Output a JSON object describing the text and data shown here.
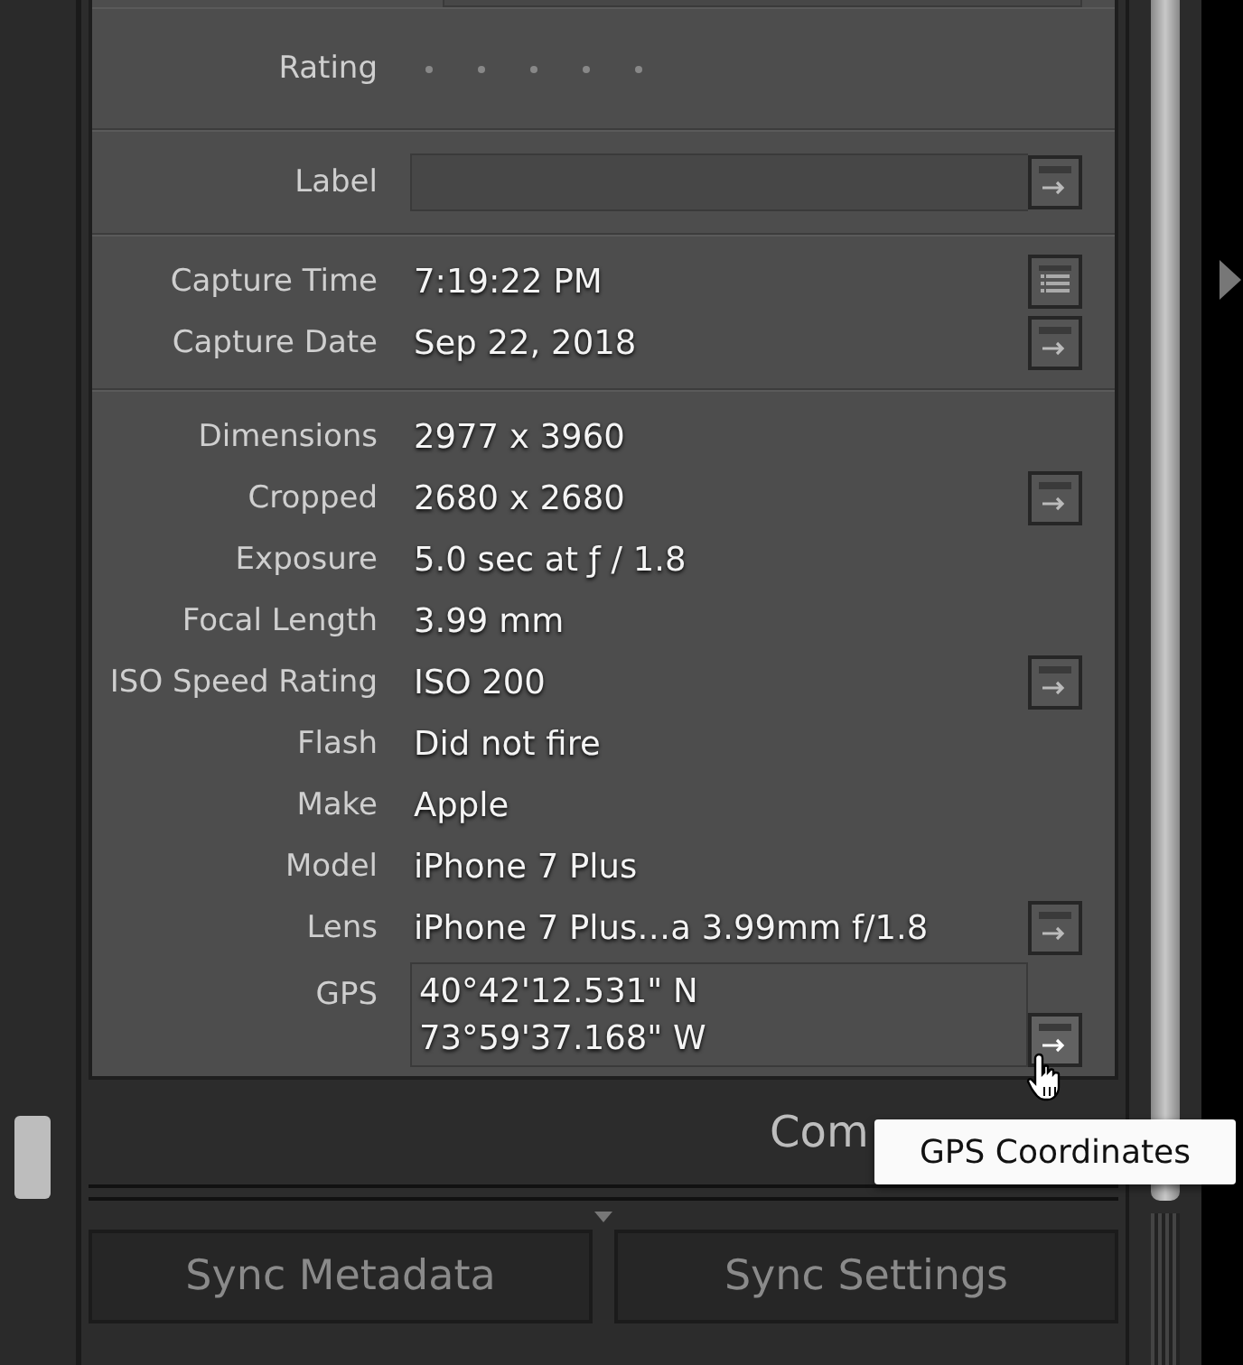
{
  "rating": {
    "label": "Rating",
    "stars": 0
  },
  "label_field": {
    "label": "Label",
    "button": {
      "kind": "arrow",
      "hovered": false
    }
  },
  "sections": [
    {
      "rows": [
        {
          "label": "Capture Time",
          "value": "7:19:22 PM",
          "button": {
            "kind": "list",
            "hovered": false
          }
        },
        {
          "label": "Capture Date",
          "value": "Sep 22, 2018",
          "button": {
            "kind": "arrow",
            "hovered": false
          }
        }
      ]
    },
    {
      "rows": [
        {
          "label": "Dimensions",
          "value": "2977 x 3960"
        },
        {
          "label": "Cropped",
          "value": "2680 x 2680",
          "button": {
            "kind": "arrow",
            "hovered": false
          }
        },
        {
          "label": "Exposure",
          "value": "5.0 sec at ƒ / 1.8"
        },
        {
          "label": "Focal Length",
          "value": "3.99 mm"
        },
        {
          "label": "ISO Speed Rating",
          "value": "ISO 200",
          "button": {
            "kind": "arrow",
            "hovered": false
          }
        },
        {
          "label": "Flash",
          "value": "Did not fire"
        },
        {
          "label": "Make",
          "value": "Apple"
        },
        {
          "label": "Model",
          "value": "iPhone 7 Plus"
        },
        {
          "label": "Lens",
          "value": "iPhone 7 Plus…a 3.99mm f/1.8",
          "button": {
            "kind": "arrow",
            "hovered": false
          }
        },
        {
          "label": "GPS",
          "lines": [
            "40°42'12.531\" N",
            "73°59'37.168\" W"
          ],
          "button": {
            "kind": "arrow",
            "hovered": true
          }
        }
      ]
    }
  ],
  "comments_heading": "Com",
  "tooltip": "GPS Coordinates",
  "buttons": [
    {
      "label": "Sync Metadata",
      "disabled": true
    },
    {
      "label": "Sync Settings",
      "disabled": true
    }
  ]
}
